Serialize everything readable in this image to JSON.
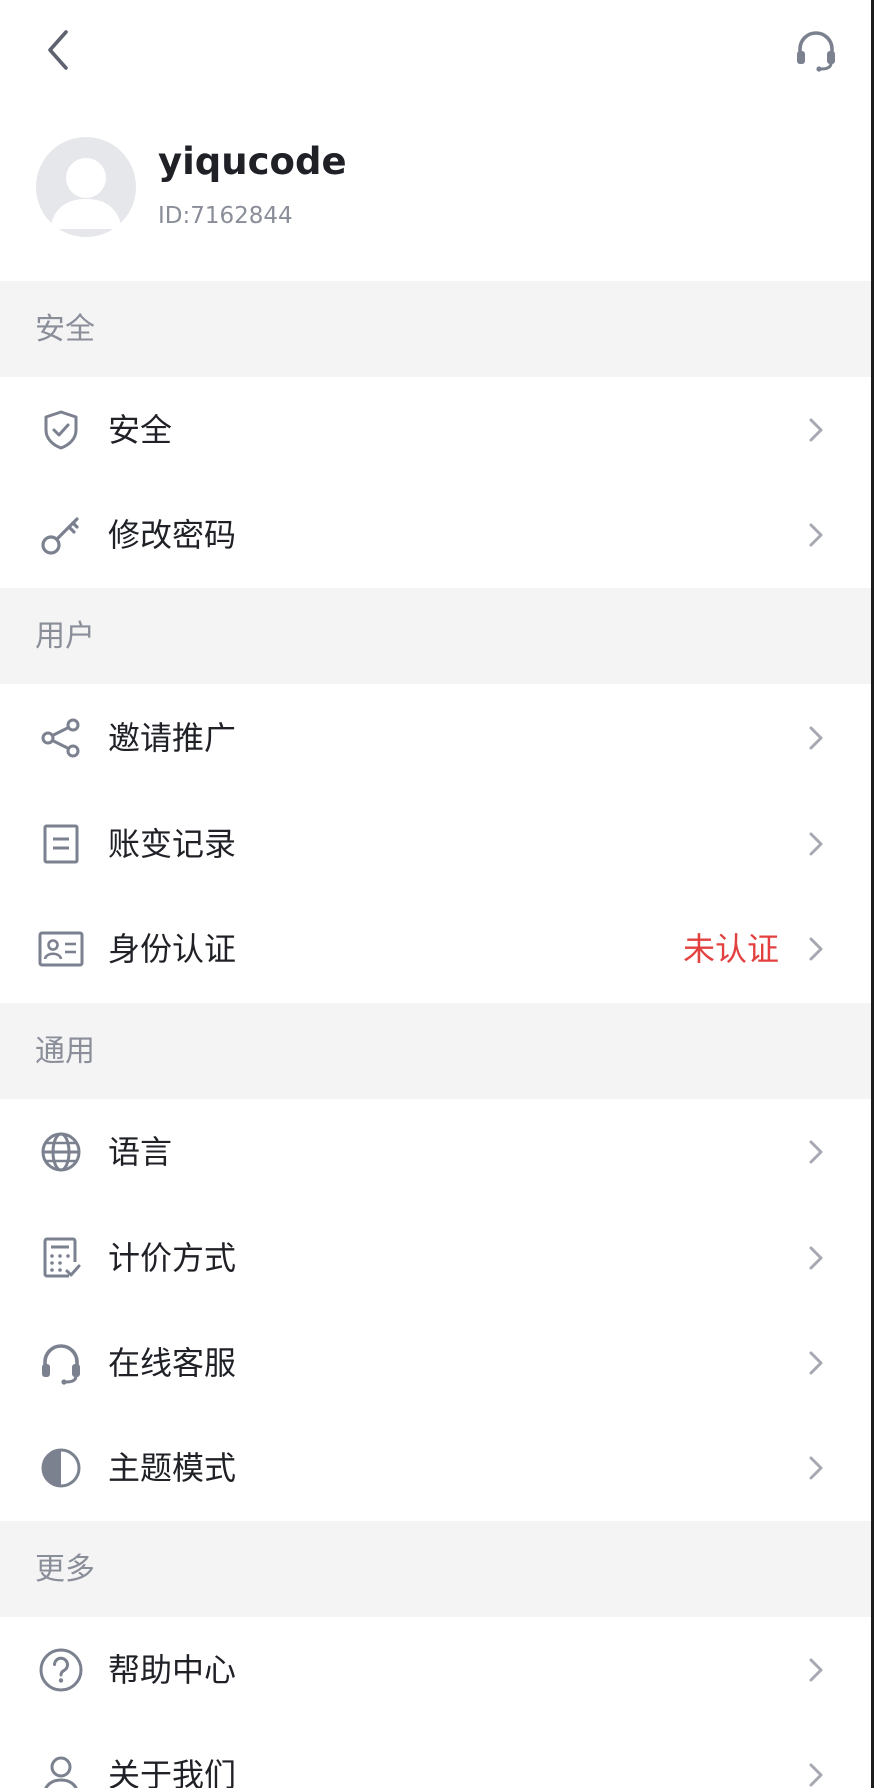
{
  "profile": {
    "username": "yiqucode",
    "user_id": "ID:7162844"
  },
  "icons": {
    "back": "chevron-left-icon",
    "support": "headset-icon",
    "avatar": "default-avatar-icon"
  },
  "colors": {
    "icon": "#7c8190",
    "chevron": "#a6a9b1",
    "status_unverified": "#e2413f",
    "section_bg": "#f4f4f5"
  },
  "sections": [
    {
      "title": "安全",
      "items": [
        {
          "label": "安全",
          "icon": "shield-icon"
        },
        {
          "label": "修改密码",
          "icon": "key-icon"
        }
      ]
    },
    {
      "title": "用户",
      "items": [
        {
          "label": "邀请推广",
          "icon": "share-icon"
        },
        {
          "label": "账变记录",
          "icon": "document-icon"
        },
        {
          "label": "身份认证",
          "icon": "id-card-icon",
          "status": "未认证"
        }
      ]
    },
    {
      "title": "通用",
      "items": [
        {
          "label": "语言",
          "icon": "globe-icon"
        },
        {
          "label": "计价方式",
          "icon": "calculator-icon"
        },
        {
          "label": "在线客服",
          "icon": "headset-icon"
        },
        {
          "label": "主题模式",
          "icon": "half-circle-icon"
        }
      ]
    },
    {
      "title": "更多",
      "items": [
        {
          "label": "帮助中心",
          "icon": "question-circle-icon"
        },
        {
          "label": "关于我们",
          "icon": "user-icon"
        }
      ]
    }
  ]
}
